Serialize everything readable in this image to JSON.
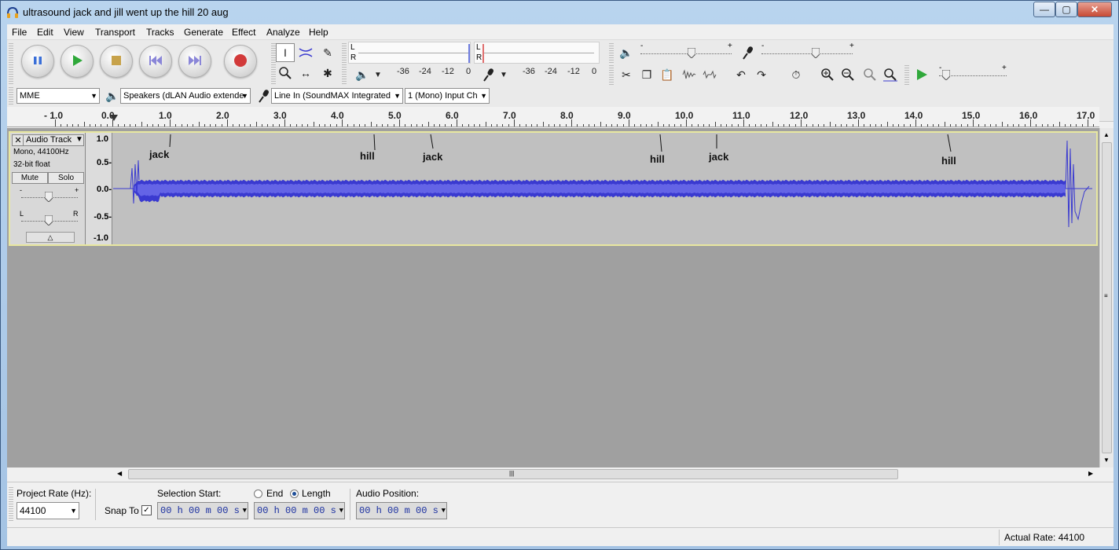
{
  "window": {
    "title": "ultrasound jack and jill went up the hill 20 aug",
    "controls": [
      "—",
      "▢",
      "✕"
    ]
  },
  "menu": [
    "File",
    "Edit",
    "View",
    "Transport",
    "Tracks",
    "Generate",
    "Effect",
    "Analyze",
    "Help"
  ],
  "transport": {
    "buttons": [
      "pause-icon",
      "play-icon",
      "stop-icon",
      "skip-start-icon",
      "skip-end-icon",
      "record-icon"
    ]
  },
  "meters": {
    "play_L": "L",
    "play_R": "R",
    "rec_L": "L",
    "rec_R": "R",
    "play_scale": [
      "-36",
      "-24",
      "-12",
      "0"
    ],
    "rec_scale": [
      "-36",
      "-24",
      "-12",
      "0"
    ]
  },
  "mixer": {
    "minus": "-",
    "plus": "+"
  },
  "device": {
    "host": "MME",
    "output": "Speakers (dLAN Audio extende",
    "input": "Line In (SoundMAX Integrated",
    "channels": "1 (Mono) Input Ch"
  },
  "ruler": {
    "labels": [
      "- 1.0",
      "0.0",
      "1.0",
      "2.0",
      "3.0",
      "4.0",
      "5.0",
      "6.0",
      "7.0",
      "8.0",
      "9.0",
      "10.0",
      "11.0",
      "12.0",
      "13.0",
      "14.0",
      "15.0",
      "16.0",
      "17.0"
    ]
  },
  "track": {
    "name": "Audio Track",
    "info1": "Mono, 44100Hz",
    "info2": "32-bit float",
    "mute": "Mute",
    "solo": "Solo",
    "gain_minus": "-",
    "gain_plus": "+",
    "pan_L": "L",
    "pan_R": "R",
    "vscale": [
      "1.0",
      "0.5-",
      "0.0-",
      "-0.5-",
      "-1.0"
    ],
    "annotations": [
      "jack",
      "hill",
      "jack",
      "hill",
      "jack",
      "hill"
    ]
  },
  "selection": {
    "rate_label": "Project Rate (Hz):",
    "rate_value": "44100",
    "snap_label": "Snap To",
    "start_label": "Selection Start:",
    "end_label": "End",
    "length_label": "Length",
    "audio_pos_label": "Audio Position:",
    "start_time": "00 h 00 m 00 s",
    "length_time": "00 h 00 m 00 s",
    "audio_pos_time": "00 h 00 m 00 s"
  },
  "status": {
    "actual_rate": "Actual Rate: 44100"
  },
  "colors": {
    "waveform": "#3a3ad0",
    "waveform_rms": "#6464e6",
    "track_bg": "#c0c0c0",
    "selected_border": "#e8e7a0"
  }
}
